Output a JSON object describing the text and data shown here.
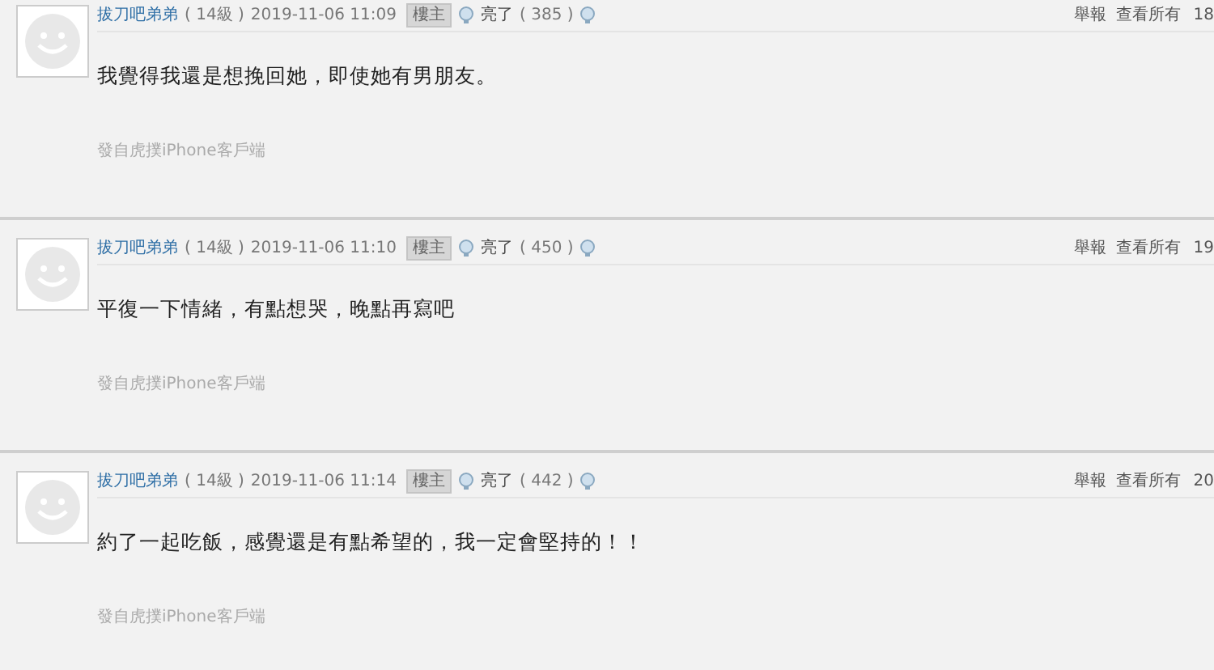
{
  "posts": [
    {
      "user": "拔刀吧弟弟",
      "level": "( 14級 )",
      "time": "2019-11-06 11:09",
      "badge": "樓主",
      "like_label": "亮了",
      "like_count": "( 385 )",
      "actions": [
        "舉報",
        "查看所有"
      ],
      "floor": "18",
      "body": "我覺得我還是想挽回她，即使她有男朋友。",
      "source": "發自虎撲iPhone客戶端"
    },
    {
      "user": "拔刀吧弟弟",
      "level": "( 14級 )",
      "time": "2019-11-06 11:10",
      "badge": "樓主",
      "like_label": "亮了",
      "like_count": "( 450 )",
      "actions": [
        "舉報",
        "查看所有"
      ],
      "floor": "19",
      "body": "平復一下情緒，有點想哭，晚點再寫吧",
      "source": "發自虎撲iPhone客戶端"
    },
    {
      "user": "拔刀吧弟弟",
      "level": "( 14級 )",
      "time": "2019-11-06 11:14",
      "badge": "樓主",
      "like_label": "亮了",
      "like_count": "( 442 )",
      "actions": [
        "舉報",
        "查看所有"
      ],
      "floor": "20",
      "body": "約了一起吃飯，感覺還是有點希望的，我一定會堅持的！！",
      "source": "發自虎撲iPhone客戶端"
    }
  ]
}
